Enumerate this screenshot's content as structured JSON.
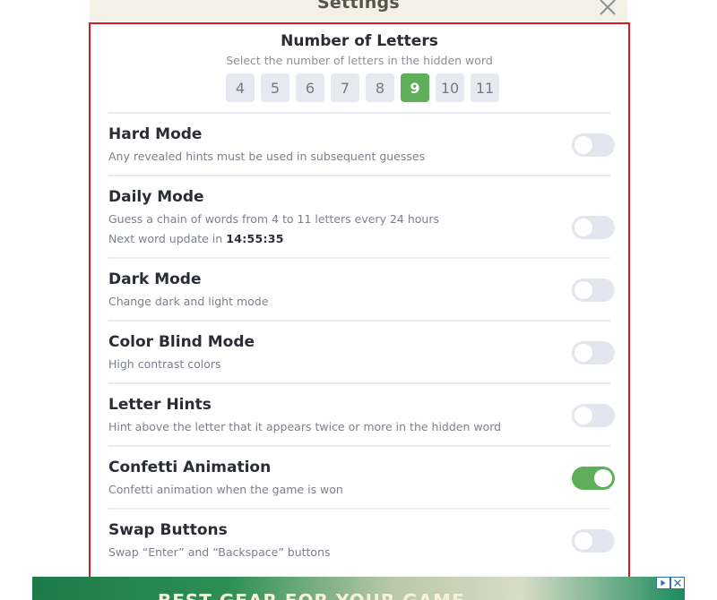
{
  "modal": {
    "title": "Settings"
  },
  "letters": {
    "title": "Number of Letters",
    "subtitle": "Select the number of letters in the hidden word",
    "options": [
      "4",
      "5",
      "6",
      "7",
      "8",
      "9",
      "10",
      "11"
    ],
    "selected": "9"
  },
  "settings": [
    {
      "title": "Hard Mode",
      "description": "Any revealed hints must be used in subsequent guesses",
      "enabled": false
    },
    {
      "title": "Daily Mode",
      "description": "Guess a chain of words from 4 to 11 letters every 24 hours",
      "next_update_label": "Next word update in",
      "next_update_time": "14:55:35",
      "enabled": false
    },
    {
      "title": "Dark Mode",
      "description": "Change dark and light mode",
      "enabled": false
    },
    {
      "title": "Color Blind Mode",
      "description": "High contrast colors",
      "enabled": false
    },
    {
      "title": "Letter Hints",
      "description": "Hint above the letter that it appears twice or more in the hidden word",
      "enabled": false
    },
    {
      "title": "Confetti Animation",
      "description": "Confetti animation when the game is won",
      "enabled": true
    },
    {
      "title": "Swap Buttons",
      "description": "Swap “Enter” and “Backspace” buttons",
      "enabled": false
    }
  ],
  "ad": {
    "text": "BEST GEAR FOR YOUR GAME"
  },
  "colors": {
    "accent": "#5fae59",
    "outline": "#d9191f",
    "toggle_off": "#e3e6ee"
  }
}
